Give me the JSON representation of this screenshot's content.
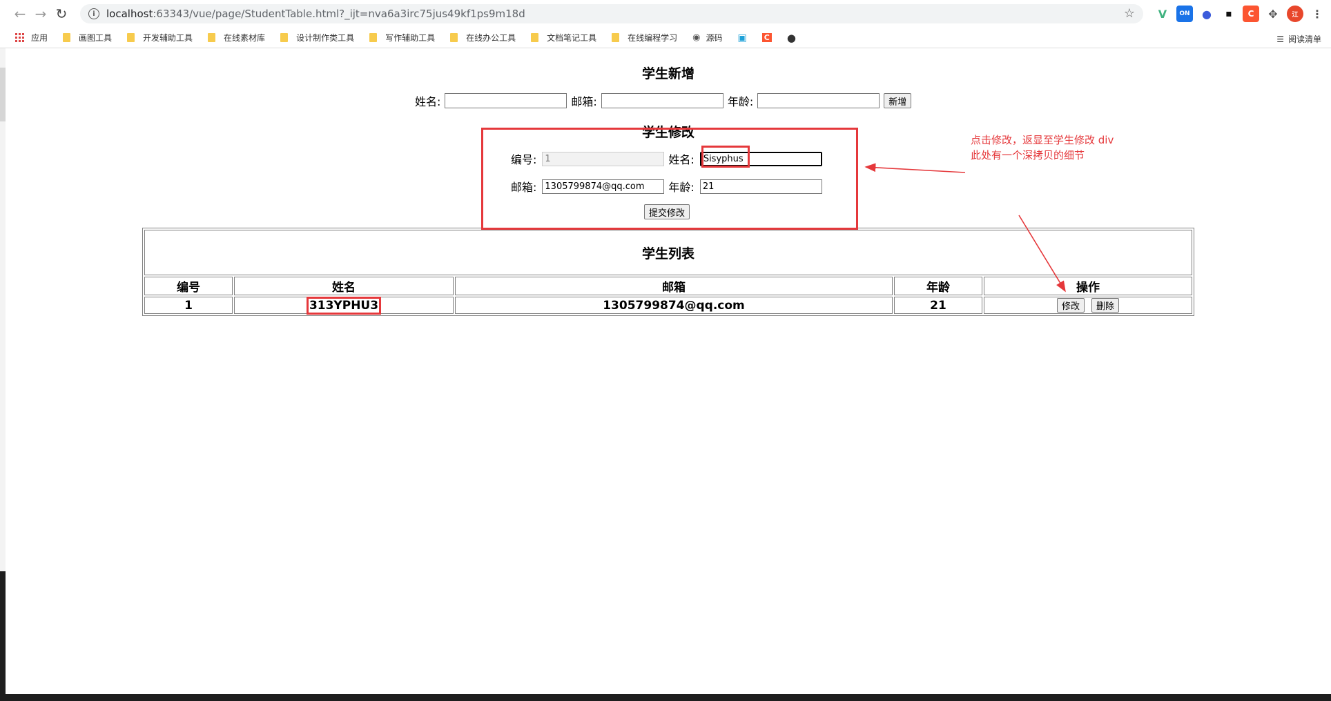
{
  "browser": {
    "url_host": "localhost",
    "url_path": ":63343/vue/page/StudentTable.html?_ijt=nva6a3irc75jus49kf1ps9m18d",
    "bookmarks": [
      "应用",
      "画图工具",
      "开发辅助工具",
      "在线素材库",
      "设计制作类工具",
      "写作辅助工具",
      "在线办公工具",
      "文档笔记工具",
      "在线编程学习",
      "源码"
    ],
    "reading_list": "阅读清单"
  },
  "add": {
    "title": "学生新增",
    "name_label": "姓名:",
    "email_label": "邮箱:",
    "age_label": "年龄:",
    "name_value": "",
    "email_value": "",
    "age_value": "",
    "add_button": "新增"
  },
  "edit": {
    "title": "学生修改",
    "id_label": "编号:",
    "id_value": "1",
    "name_label": "姓名:",
    "name_value": "Sisyphus",
    "email_label": "邮箱:",
    "email_value": "1305799874@qq.com",
    "age_label": "年龄:",
    "age_value": "21",
    "submit_button": "提交修改"
  },
  "list": {
    "title": "学生列表",
    "headers": [
      "编号",
      "姓名",
      "邮箱",
      "年龄",
      "操作"
    ],
    "rows": [
      {
        "id": "1",
        "name": "313YPHU3",
        "email": "1305799874@qq.com",
        "age": "21",
        "edit": "修改",
        "delete": "删除"
      }
    ]
  },
  "annotation": {
    "line1": "点击修改，返显至学生修改 div",
    "line2": "此处有一个深拷贝的细节",
    "color": "#e5383b"
  }
}
